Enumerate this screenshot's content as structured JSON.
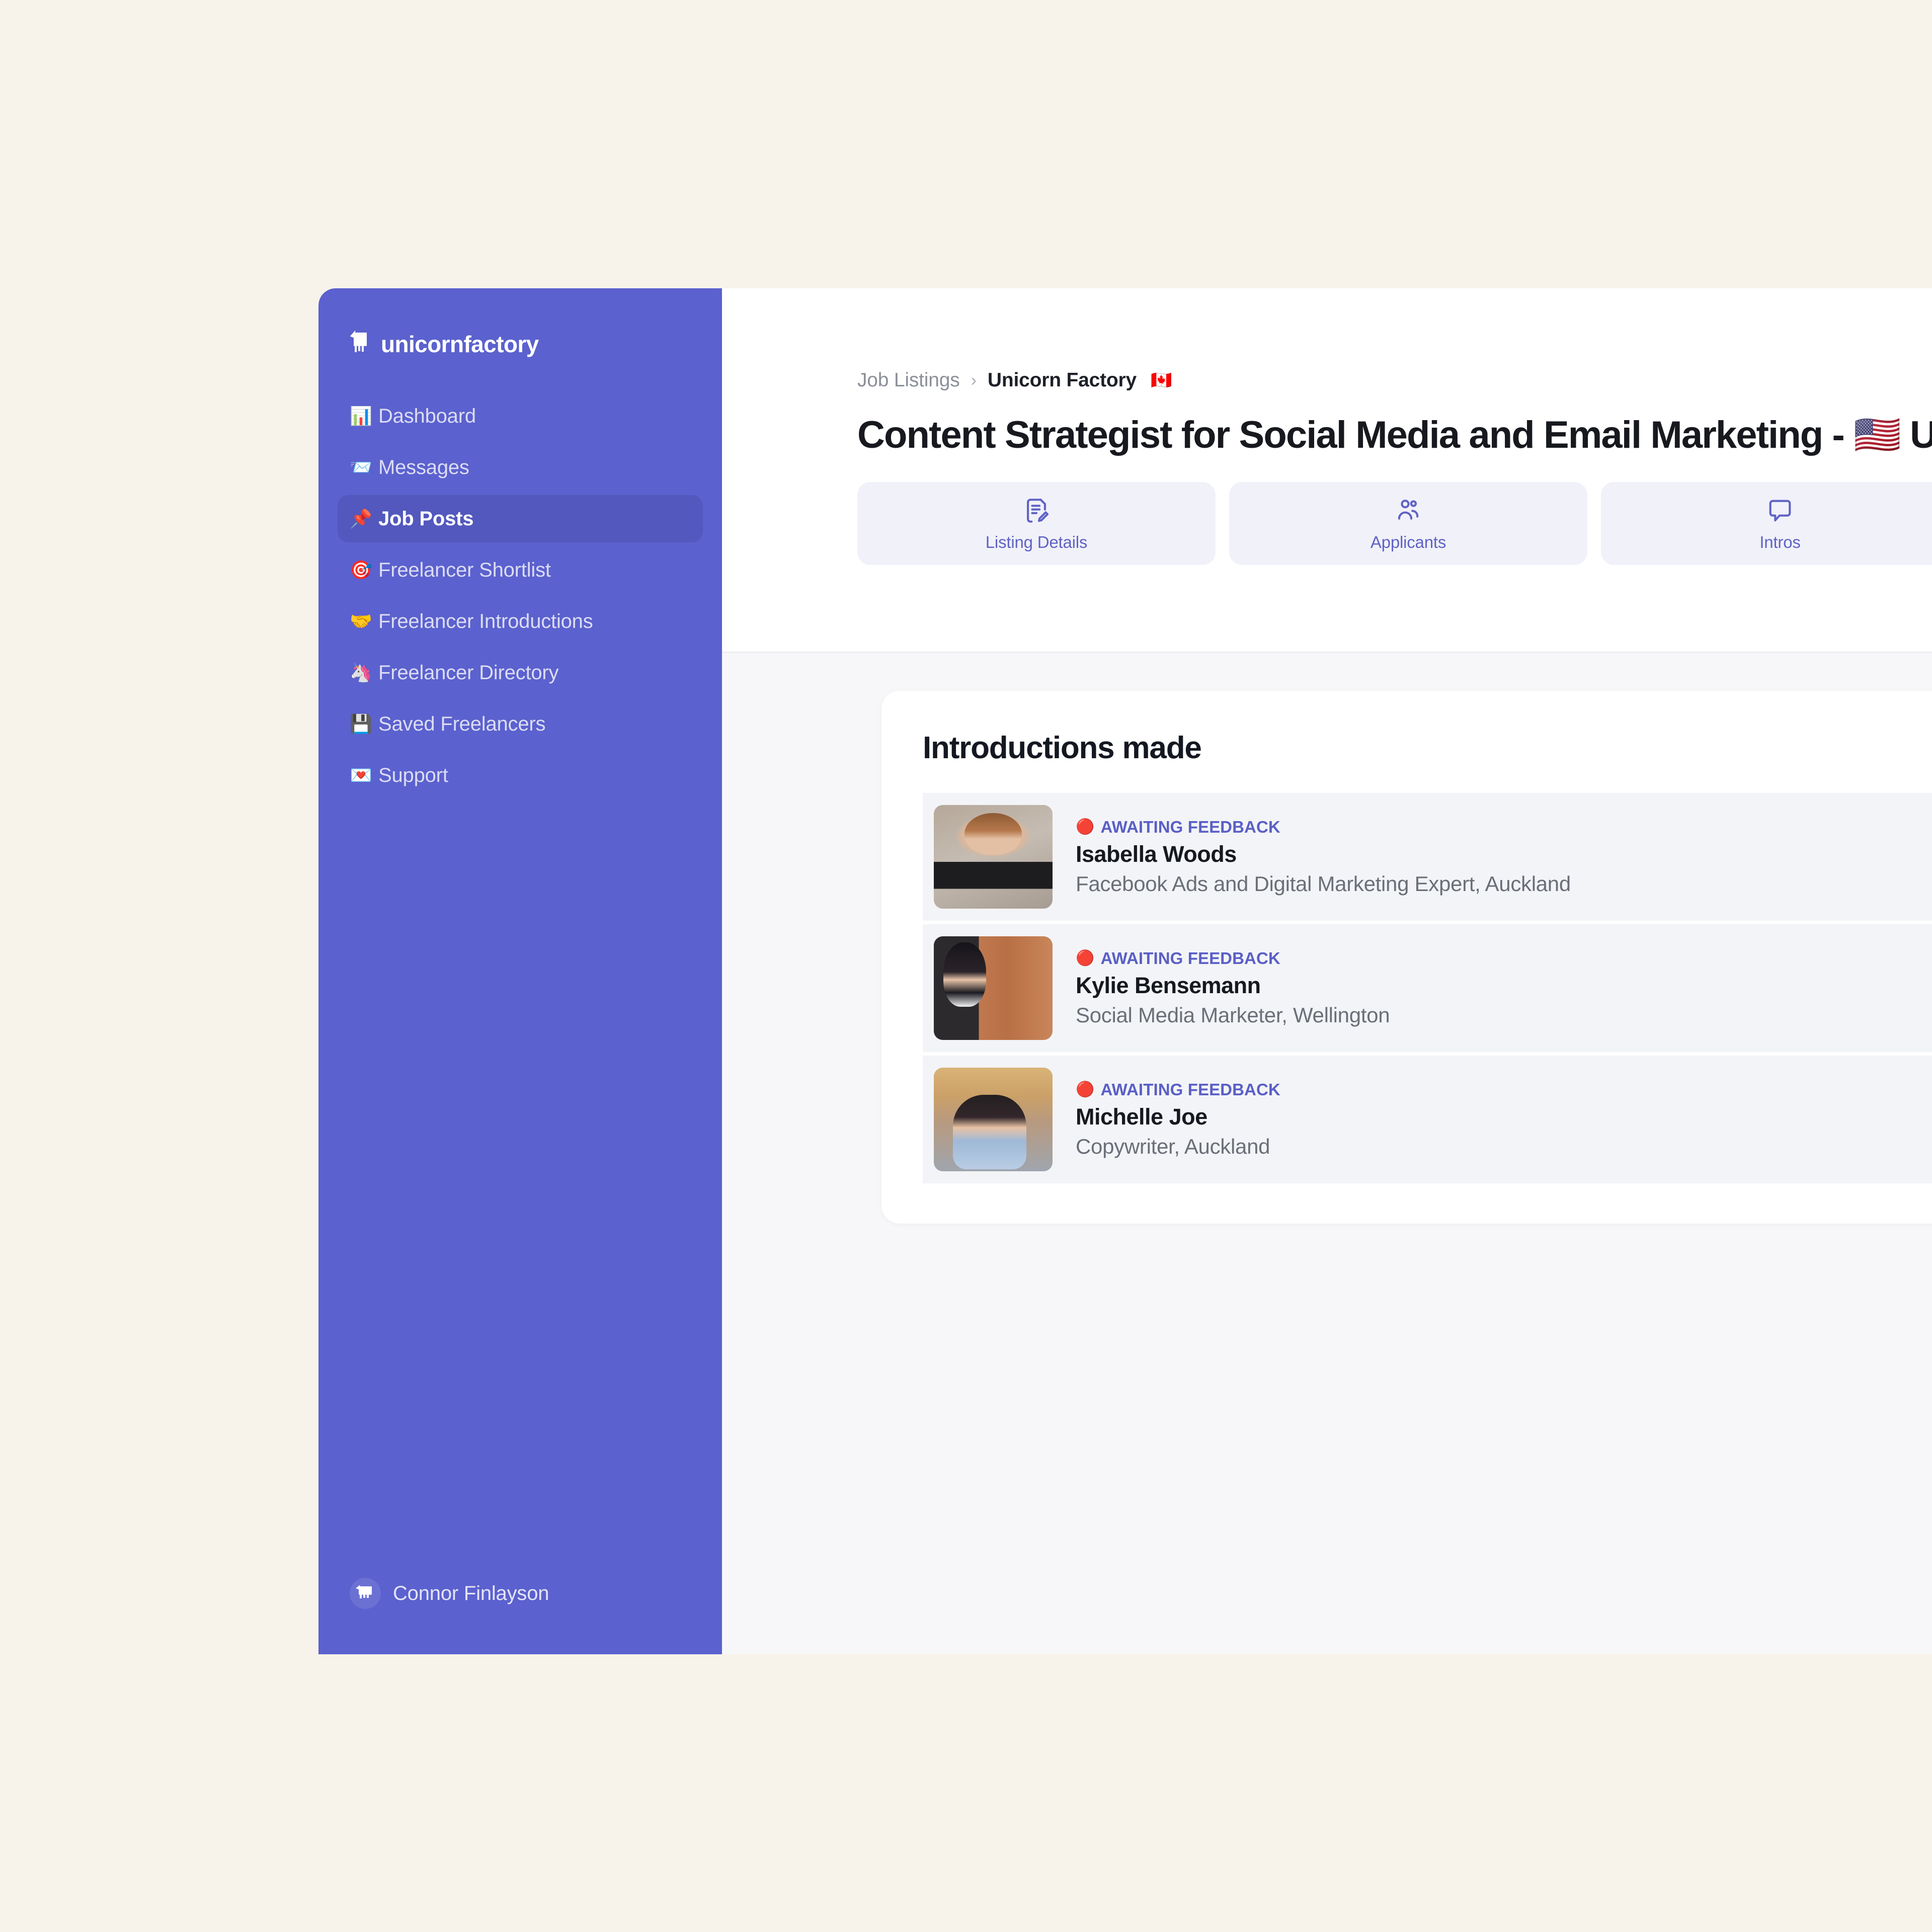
{
  "theme": {
    "page_background": "#f7f3ea",
    "sidebar_background": "#5b61ce",
    "sidebar_active_background": "#5258bd",
    "accent": "#5a5fc6",
    "content_background": "#f7f7f9",
    "card_background": "#ffffff",
    "row_background": "#f3f4f7"
  },
  "sidebar": {
    "brand": "unicornfactory",
    "brand_logo_icon": "unicorn-logo-icon",
    "items": [
      {
        "label": "Dashboard",
        "emoji": "📊",
        "icon": "bar-chart-icon",
        "active": false
      },
      {
        "label": "Messages",
        "emoji": "📨",
        "icon": "envelope-icon",
        "active": false
      },
      {
        "label": "Job Posts",
        "emoji": "📌",
        "icon": "pushpin-icon",
        "active": true
      },
      {
        "label": "Freelancer Shortlist",
        "emoji": "🎯",
        "icon": "target-icon",
        "active": false
      },
      {
        "label": "Freelancer Introductions",
        "emoji": "🤝",
        "icon": "handshake-icon",
        "active": false
      },
      {
        "label": "Freelancer Directory",
        "emoji": "🦄",
        "icon": "unicorn-icon",
        "active": false
      },
      {
        "label": "Saved Freelancers",
        "emoji": "💾",
        "icon": "floppy-disk-icon",
        "active": false
      },
      {
        "label": "Support",
        "emoji": "💌",
        "icon": "love-letter-icon",
        "active": false
      }
    ],
    "user": {
      "name": "Connor Finlayson",
      "avatar_icon": "unicorn-avatar-icon"
    }
  },
  "header": {
    "breadcrumb": {
      "root": "Job Listings",
      "separator": "›",
      "current": "Unicorn Factory",
      "current_flag": "🇨🇦"
    },
    "title": "Content Strategist for Social Media and Email Marketing - 🇺🇸 U",
    "tabs": [
      {
        "label": "Listing Details",
        "icon": "document-edit-icon",
        "active": false
      },
      {
        "label": "Applicants",
        "icon": "users-icon",
        "active": false
      },
      {
        "label": "Intros",
        "icon": "speech-bubble-icon",
        "active": true
      }
    ]
  },
  "main": {
    "intros_card": {
      "title": "Introductions made",
      "rows": [
        {
          "status": "AWAITING FEEDBACK",
          "status_dot": "🔴",
          "name": "Isabella Woods",
          "role": "Facebook Ads and Digital Marketing Expert, Auckland",
          "avatar": "isabella"
        },
        {
          "status": "AWAITING FEEDBACK",
          "status_dot": "🔴",
          "name": "Kylie Bensemann",
          "role": "Social Media Marketer, Wellington",
          "avatar": "kylie"
        },
        {
          "status": "AWAITING FEEDBACK",
          "status_dot": "🔴",
          "name": "Michelle Joe",
          "role": "Copywriter, Auckland",
          "avatar": "michelle"
        }
      ]
    }
  }
}
